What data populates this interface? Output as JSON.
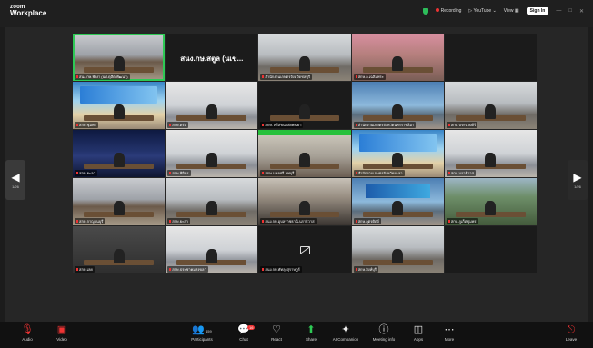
{
  "app": {
    "brand_small": "zoom",
    "brand_large": "Workplace"
  },
  "topbar": {
    "recording": "Recording",
    "youtube": "YouTube",
    "view": "View",
    "sign_in": "Sign In"
  },
  "gallery": {
    "page_left": "1/26",
    "page_right": "1/26",
    "tiles": [
      {
        "name": "สนง.กษ.พังงา (นศ.ดุสิต-พัฒนา)",
        "style": "t-room",
        "active": true
      },
      {
        "name": "",
        "style": "t-dark",
        "big_label": "สนง.กษ.สตูล (นเข..."
      },
      {
        "name": "สำนักงานเกษตรจังหวัดชลบุรี",
        "style": "t-office"
      },
      {
        "name": "สกษ.อ.เฉลิมพระ",
        "style": "t-pink"
      },
      {
        "name": "",
        "style": "t-dark",
        "empty": true
      },
      {
        "name": "สกษ.ชุมพร",
        "style": "t-poster",
        "banner": true
      },
      {
        "name": "สกษ.ตรัง",
        "style": "t-white"
      },
      {
        "name": "สกษ. ศรีสัชนาลัยพะเยา",
        "style": "t-dark"
      },
      {
        "name": "สำนักงานเกษตรจังหวัดนครราชสีมา",
        "style": "t-blue"
      },
      {
        "name": "สกษ.ประจวบคีรี",
        "style": "t-office"
      },
      {
        "name": "สกษ.ยะลา",
        "style": "t-night"
      },
      {
        "name": "สกษ.พิจิตร",
        "style": "t-white"
      },
      {
        "name": "สกษ.นครศรี-ลพบุรี",
        "style": "t-green"
      },
      {
        "name": "สำนักงานเกษตรจังหวัดยะลา",
        "style": "t-poster",
        "banner": true
      },
      {
        "name": "สกษ.นราธิวาส",
        "style": "t-white"
      },
      {
        "name": "สกษ.กาญจนบุรี",
        "style": "t-room"
      },
      {
        "name": "สกษ.ยะลา",
        "style": "t-office"
      },
      {
        "name": "สนง.กษ.อุบลราชธานี-นราธิวาส",
        "style": "t-face"
      },
      {
        "name": "สกษ.อุตรดิตถ์",
        "style": "t-blue",
        "banner2": true
      },
      {
        "name": "สกษ.ภูเก็ตชุมพร",
        "style": "t-mount"
      },
      {
        "name": "สกษ.เลย",
        "style": "t-dim"
      },
      {
        "name": "สกษ.ประชาคมสงขลา",
        "style": "t-white"
      },
      {
        "name": "สนง.กษ.พัทลุงสุราษฎร์",
        "style": "t-dark",
        "camoff": true
      },
      {
        "name": "สกษ.สิงห์บุรี",
        "style": "t-office"
      },
      {
        "name": "",
        "style": "t-dark",
        "empty": true
      }
    ]
  },
  "toolbar": {
    "audio": "Audio",
    "video": "Video",
    "participants": "Participants",
    "participants_count": "459",
    "chat": "Chat",
    "chat_badge": "16",
    "react": "React",
    "share": "Share",
    "ai_companion": "AI Companion",
    "meeting_info": "Meeting info",
    "apps": "Apps",
    "more": "More",
    "leave": "Leave"
  },
  "colors": {
    "active_speaker": "#2ec955",
    "leave": "#e33333",
    "background": "#1c1c1c"
  }
}
